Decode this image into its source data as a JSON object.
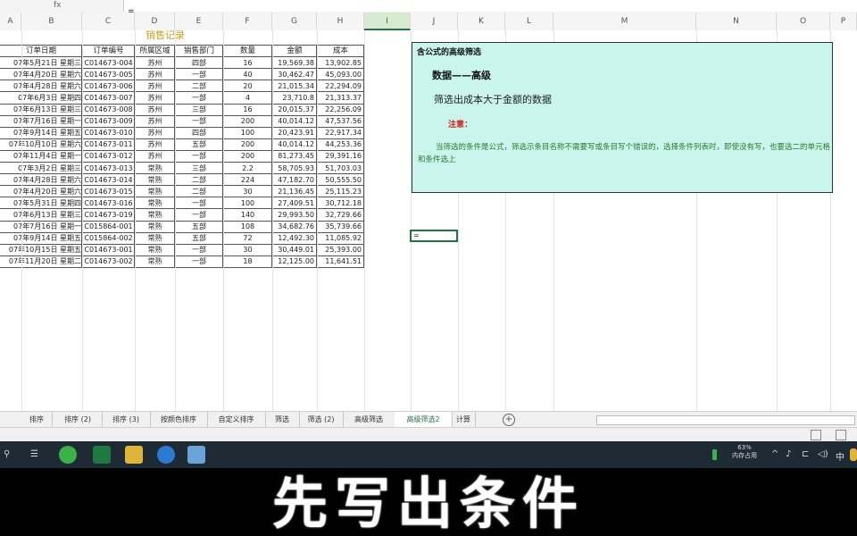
{
  "formula_bar": {
    "fx": "fx",
    "value": "="
  },
  "columns": [
    "A",
    "B",
    "C",
    "D",
    "E",
    "F",
    "G",
    "H",
    "I",
    "J",
    "K",
    "L",
    "M",
    "N",
    "O",
    "P"
  ],
  "selected_column": "I",
  "sheet_title": "销售记录",
  "table": {
    "headers": [
      "订单日期",
      "订单编号",
      "所属区域",
      "销售部门",
      "数量",
      "金额",
      "成本"
    ],
    "rows": [
      [
        "07年5月21日 星期三",
        "C014673-004",
        "苏州",
        "四部",
        "16",
        "19,569.38",
        "13,902.85"
      ],
      [
        "07年4月20日 星期六",
        "C014673-005",
        "苏州",
        "一部",
        "40",
        "30,462.47",
        "45,093.00"
      ],
      [
        "07年4月28日 星期六",
        "C014673-006",
        "苏州",
        "二部",
        "20",
        "21,015.34",
        "22,294.09"
      ],
      [
        "07年6月3日 星期四",
        "C014673-007",
        "苏州",
        "一部",
        "4",
        "23,710.8",
        "21,313.37"
      ],
      [
        "07年6月13日 星期三",
        "C014673-008",
        "苏州",
        "三部",
        "16",
        "20,015.37",
        "22,256.09"
      ],
      [
        "07年7月16日 星期一",
        "C014673-009",
        "苏州",
        "一部",
        "200",
        "40,014.12",
        "47,537.56"
      ],
      [
        "07年9月14日 星期五",
        "C014673-010",
        "苏州",
        "四部",
        "100",
        "20,423.91",
        "22,917.34"
      ],
      [
        "07年10月10日 星期六",
        "C014673-011",
        "苏州",
        "五部",
        "200",
        "40,014.12",
        "44,253.36"
      ],
      [
        "07年11月4日 星期一",
        "C014673-012",
        "苏州",
        "一部",
        "200",
        "81,273.45",
        "29,391.16"
      ],
      [
        "07年3月2日 星期三",
        "C014673-013",
        "常熟",
        "三部",
        "2.2",
        "58,705.93",
        "51,703.03"
      ],
      [
        "07年4月28日 星期六",
        "C014673-014",
        "常熟",
        "二部",
        "224",
        "47,182.70",
        "50,555.50"
      ],
      [
        "07年4月20日 星期六",
        "C014673-015",
        "常熟",
        "二部",
        "30",
        "21,136.45",
        "25,115.23"
      ],
      [
        "07年5月31日 星期四",
        "C014673-016",
        "常熟",
        "一部",
        "100",
        "27,409.51",
        "30,712.18"
      ],
      [
        "07年6月13日 星期三",
        "C014673-019",
        "常熟",
        "一部",
        "140",
        "29,993.50",
        "32,729.66"
      ],
      [
        "07年7月16日 星期一",
        "C015864-001",
        "常熟",
        "五部",
        "108",
        "34,682.76",
        "35,739.66"
      ],
      [
        "07年9月14日 星期五",
        "C015864-002",
        "常熟",
        "五部",
        "72",
        "12,492.30",
        "11,085.92"
      ],
      [
        "07年10月15日 星期五",
        "C014673-001",
        "常熟",
        "一部",
        "30",
        "30,449.01",
        "25,393.00"
      ],
      [
        "07年11月20日 星期二",
        "C014673-002",
        "常熟",
        "一部",
        "18",
        "12,125.00",
        "11,641.51"
      ]
    ]
  },
  "note": {
    "title": "含公式的高级筛选",
    "path": "数据——高级",
    "desc": "筛选出成本大于金额的数据",
    "warn": "注意：",
    "body": "当筛选的条件是公式，筛选示条目名称不需要写或条目写个错误的，选择条件列表时，即使没有写，也要选二的单元格和条件选上"
  },
  "active_cell": {
    "value": "="
  },
  "sheet_tabs": [
    "排序",
    "排序 (2)",
    "排序 (3)",
    "按颜色排序",
    "自定义排序",
    "筛选",
    "筛选 (2)",
    "高级筛选",
    "高级筛选2",
    "计算"
  ],
  "active_tab": 8,
  "taskbar": {
    "battery_percent": "63%",
    "battery_label": "内存占用"
  },
  "caption": "先写出条件",
  "colors": {
    "excel_green": "#217346",
    "note_bg": "#c9f5ec",
    "title_gold": "#c9a227",
    "warn_red": "#d21f1f",
    "body_green": "#2b7a2b"
  }
}
